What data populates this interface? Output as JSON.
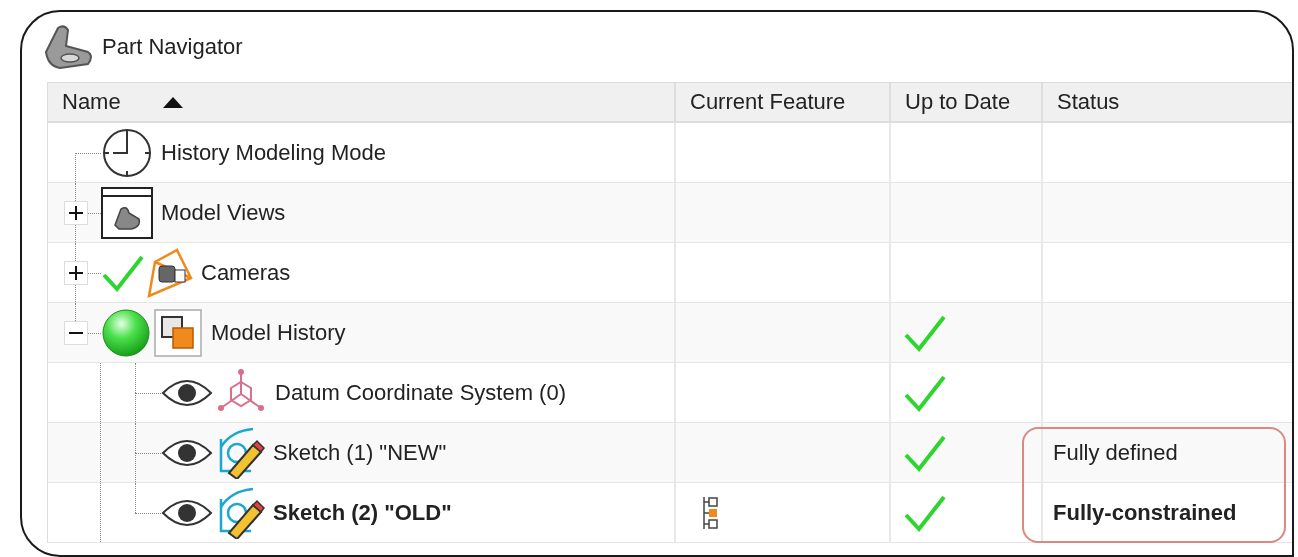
{
  "window": {
    "title": "Part Navigator"
  },
  "columns": [
    {
      "label": "Name",
      "sorted": true
    },
    {
      "label": "Current Feature",
      "sorted": false
    },
    {
      "label": "Up to Date",
      "sorted": false
    },
    {
      "label": "Status",
      "sorted": false
    }
  ],
  "tree": [
    {
      "name": "History Modeling Mode",
      "kind": "clock",
      "up_to_date": false
    },
    {
      "name": "Model Views",
      "kind": "views",
      "expanded": false,
      "up_to_date": false
    },
    {
      "name": "Cameras",
      "kind": "camera",
      "marker": {
        "kind": "check"
      },
      "expanded": false,
      "up_to_date": false
    },
    {
      "name": "Model History",
      "kind": "history",
      "marker": {
        "kind": "ball"
      },
      "expanded": true,
      "up_to_date": true,
      "children": [
        {
          "name": "Datum Coordinate System (0)",
          "kind": "datum",
          "marker": {
            "kind": "eye"
          },
          "up_to_date": true,
          "current": false,
          "highlighted": false
        },
        {
          "name": "Sketch (1) \"NEW\"",
          "kind": "sketch",
          "marker": {
            "kind": "eye"
          },
          "up_to_date": true,
          "current": false,
          "status": "Fully defined",
          "highlighted": true
        },
        {
          "name": "Sketch (2) \"OLD\"",
          "kind": "sketch",
          "marker": {
            "kind": "eye"
          },
          "up_to_date": true,
          "current": true,
          "status": "Fully-constrained",
          "highlighted": true
        }
      ]
    }
  ]
}
